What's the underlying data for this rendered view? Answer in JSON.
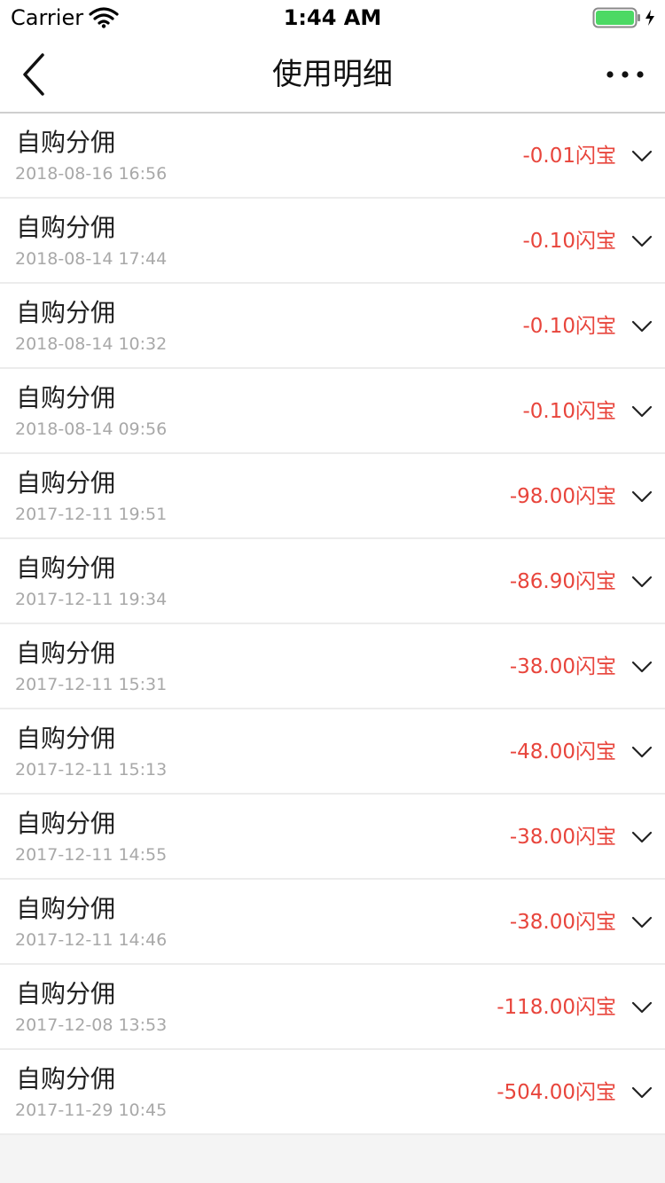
{
  "status_bar": {
    "carrier": "Carrier",
    "time": "1:44 AM",
    "battery_color": "#4cd964"
  },
  "navbar": {
    "title": "使用明细",
    "back_icon": "chevron-left-icon",
    "more_icon": "more-horizontal-icon"
  },
  "transactions": [
    {
      "title": "自购分佣",
      "date": "2018-08-16 16:56",
      "amount": "-0.01闪宝"
    },
    {
      "title": "自购分佣",
      "date": "2018-08-14 17:44",
      "amount": "-0.10闪宝"
    },
    {
      "title": "自购分佣",
      "date": "2018-08-14 10:32",
      "amount": "-0.10闪宝"
    },
    {
      "title": "自购分佣",
      "date": "2018-08-14 09:56",
      "amount": "-0.10闪宝"
    },
    {
      "title": "自购分佣",
      "date": "2017-12-11 19:51",
      "amount": "-98.00闪宝"
    },
    {
      "title": "自购分佣",
      "date": "2017-12-11 19:34",
      "amount": "-86.90闪宝"
    },
    {
      "title": "自购分佣",
      "date": "2017-12-11 15:31",
      "amount": "-38.00闪宝"
    },
    {
      "title": "自购分佣",
      "date": "2017-12-11 15:13",
      "amount": "-48.00闪宝"
    },
    {
      "title": "自购分佣",
      "date": "2017-12-11 14:55",
      "amount": "-38.00闪宝"
    },
    {
      "title": "自购分佣",
      "date": "2017-12-11 14:46",
      "amount": "-38.00闪宝"
    },
    {
      "title": "自购分佣",
      "date": "2017-12-08 13:53",
      "amount": "-118.00闪宝"
    },
    {
      "title": "自购分佣",
      "date": "2017-11-29 10:45",
      "amount": "-504.00闪宝"
    }
  ],
  "colors": {
    "amount": "#e8453c",
    "date": "#a8a8a8",
    "background": "#f4f4f4"
  }
}
